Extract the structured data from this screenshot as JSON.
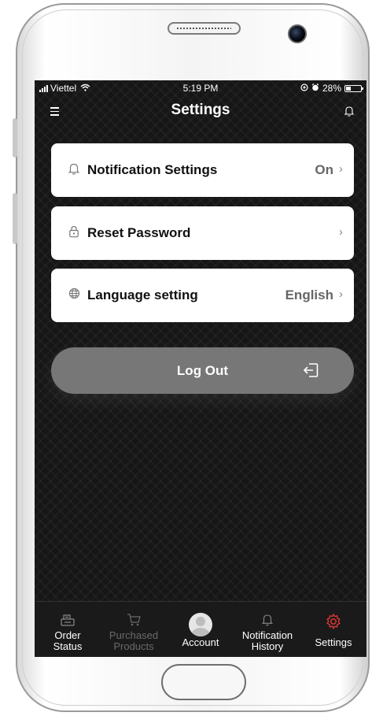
{
  "status_bar": {
    "carrier": "Viettel",
    "time": "5:19 PM",
    "battery": "28%"
  },
  "header": {
    "title": "Settings"
  },
  "settings": [
    {
      "label": "Notification Settings",
      "value": "On",
      "icon": "bell-icon"
    },
    {
      "label": "Reset Password",
      "value": "",
      "icon": "lock-icon"
    },
    {
      "label": "Language setting",
      "value": "English",
      "icon": "globe-icon"
    }
  ],
  "logout": {
    "label": "Log Out",
    "icon": "logout-icon"
  },
  "tabbar": [
    {
      "label": "Order\nStatus",
      "icon": "order-status-icon",
      "state": "normal"
    },
    {
      "label": "Purchased\nProducts",
      "icon": "cart-icon",
      "state": "dim"
    },
    {
      "label": "Account",
      "icon": "avatar",
      "state": "normal"
    },
    {
      "label": "Notification\nHistory",
      "icon": "bell-icon",
      "state": "normal"
    },
    {
      "label": "Settings",
      "icon": "gear-icon",
      "state": "active"
    }
  ],
  "colors": {
    "screen_bg": "#161616",
    "card_bg": "#ffffff",
    "logout_bg": "#777777",
    "active_tab": "#e53935"
  }
}
